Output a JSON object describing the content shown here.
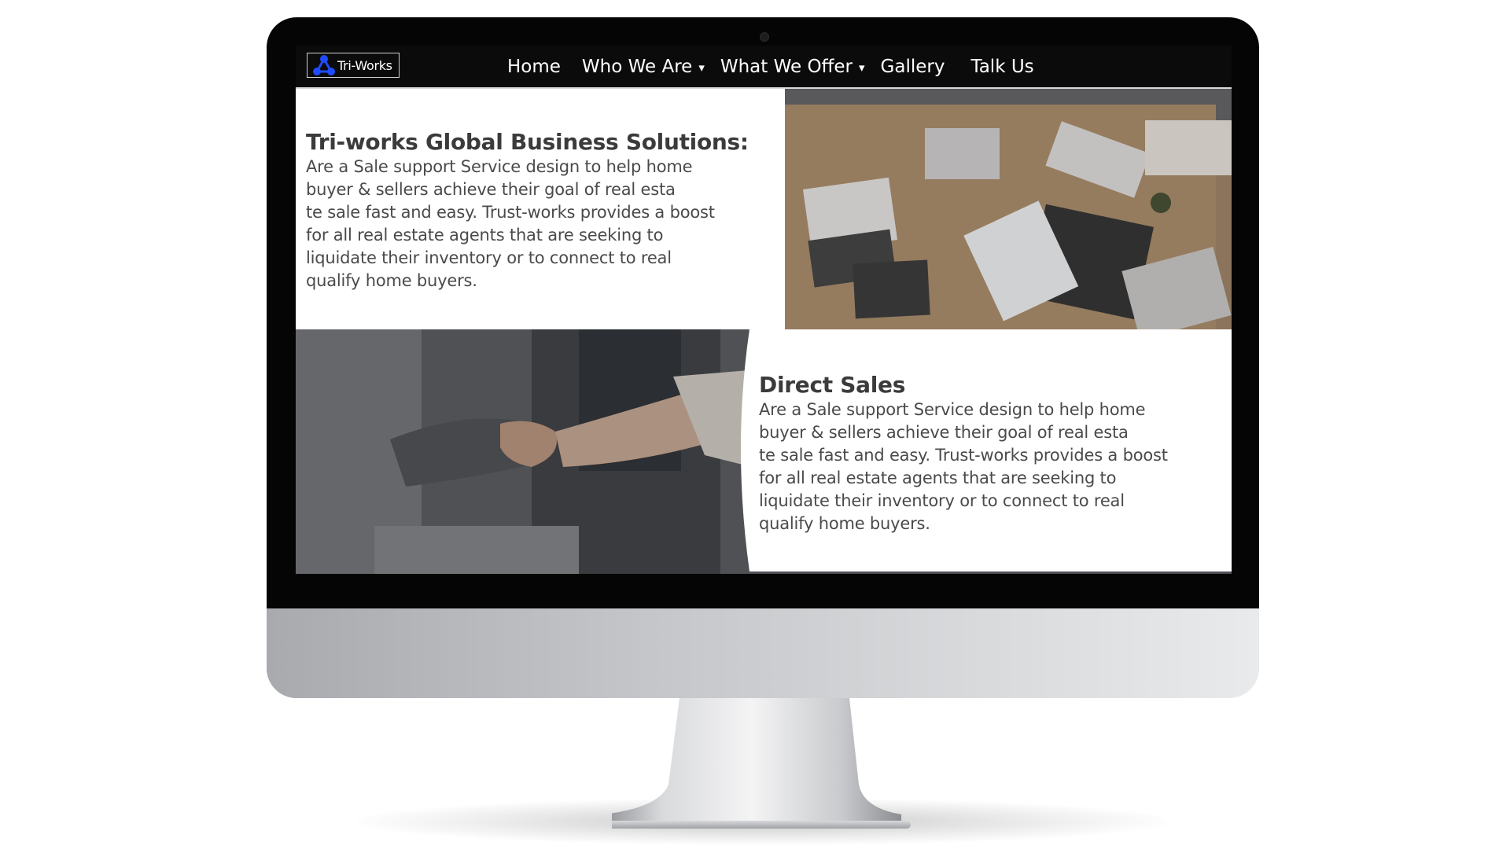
{
  "site": {
    "logo_text": "Tri-Works"
  },
  "nav": {
    "items": [
      {
        "label": "Home",
        "has_dropdown": false
      },
      {
        "label": "Who We Are",
        "has_dropdown": true
      },
      {
        "label": "What We Offer",
        "has_dropdown": true
      },
      {
        "label": "Gallery",
        "has_dropdown": false
      },
      {
        "label": "Talk Us",
        "has_dropdown": false
      }
    ],
    "caret": "▾"
  },
  "sections": [
    {
      "heading": "Tri-works Global Business Solutions:",
      "body_lines": [
        "Are a Sale support Service design to help home",
        "buyer & sellers achieve their goal of real esta",
        "te sale fast and easy. Trust-works provides a boost",
        "for all real estate agents that are seeking to",
        " liquidate their inventory or to connect to real",
        "qualify home buyers."
      ],
      "image": "business-meeting-desk-photo"
    },
    {
      "heading": "Direct Sales",
      "body_lines": [
        "Are a Sale support Service design to help home",
        "buyer & sellers achieve their goal of real esta",
        "te sale fast and easy. Trust-works provides a boost",
        "for all real estate agents that are seeking to",
        " liquidate their inventory or to connect to real",
        "qualify home buyers."
      ],
      "image": "handshake-photo"
    }
  ],
  "colors": {
    "nav_background": "#0b0b0b",
    "heading_text": "#3b3b3b",
    "body_text": "#4a4a4a",
    "logo_accent": "#1f4bff"
  }
}
